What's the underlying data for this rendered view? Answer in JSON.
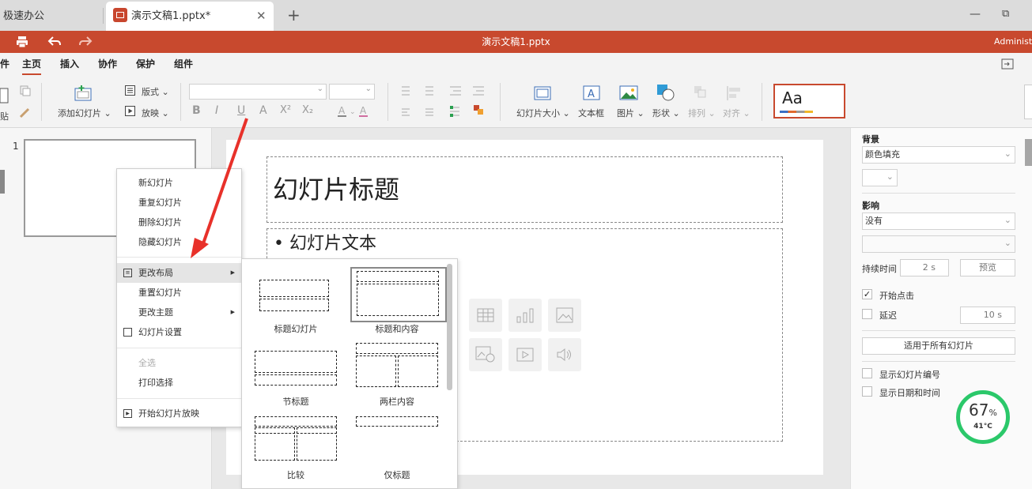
{
  "tabs": {
    "home_label": "极速办公",
    "doc_label": "演示文稿1.pptx*",
    "close_glyph": "✕",
    "add_glyph": "+",
    "min_glyph": "—",
    "max_glyph": "⧉"
  },
  "titlebar": {
    "title": "演示文稿1.pptx",
    "user": "Administra",
    "accent_color": "#c8492e"
  },
  "menu": {
    "items": [
      "件",
      "主页",
      "插入",
      "协作",
      "保护",
      "组件"
    ]
  },
  "ribbon": {
    "paste_label": "贴",
    "add_slide_label": "添加幻灯片 ⌄",
    "layout_label": "版式 ⌄",
    "slideshow_label": "放映 ⌄",
    "format_buttons": [
      "B",
      "I",
      "U",
      "A",
      "X²",
      "X₂"
    ],
    "slide_size_label": "幻灯片大小 ⌄",
    "textbox_label": "文本框",
    "picture_label": "图片 ⌄",
    "shape_label": "形状 ⌄",
    "arrange_label": "排列 ⌄",
    "align_label": "对齐 ⌄",
    "theme_preview": "Aa"
  },
  "slides_panel": {
    "slide_number": "1"
  },
  "slide": {
    "title_text": "幻灯片标题",
    "body_text": "• 幻灯片文本"
  },
  "right_panel": {
    "background_heading": "背景",
    "fill_value": "颜色填充",
    "transition_heading": "影响",
    "transition_value": "没有",
    "duration_label": "持续时间",
    "duration_value": "2 s",
    "preview_button": "预览",
    "on_click_label": "开始点击",
    "on_click_checked": true,
    "delay_label": "延迟",
    "delay_value": "10 s",
    "apply_all_button": "适用于所有幻灯片",
    "show_number_label": "显示幻灯片编号",
    "show_datetime_label": "显示日期和时间"
  },
  "gauge": {
    "value": "67",
    "unit": "%",
    "temp": "41°C",
    "color": "#2bc86a"
  },
  "context_menu": {
    "new_slide": "新幻灯片",
    "duplicate_slide": "重复幻灯片",
    "delete_slide": "删除幻灯片",
    "hide_slide": "隐藏幻灯片",
    "change_layout": "更改布局",
    "reset_slide": "重置幻灯片",
    "change_theme": "更改主题",
    "slide_settings": "幻灯片设置",
    "select_all": "全选",
    "print_selection": "打印选择",
    "start_slideshow": "开始幻灯片放映"
  },
  "layouts": {
    "title_slide": "标题幻灯片",
    "title_content": "标题和内容",
    "section_header": "节标题",
    "two_content": "两栏内容",
    "comparison": "比较",
    "title_only": "仅标题"
  }
}
